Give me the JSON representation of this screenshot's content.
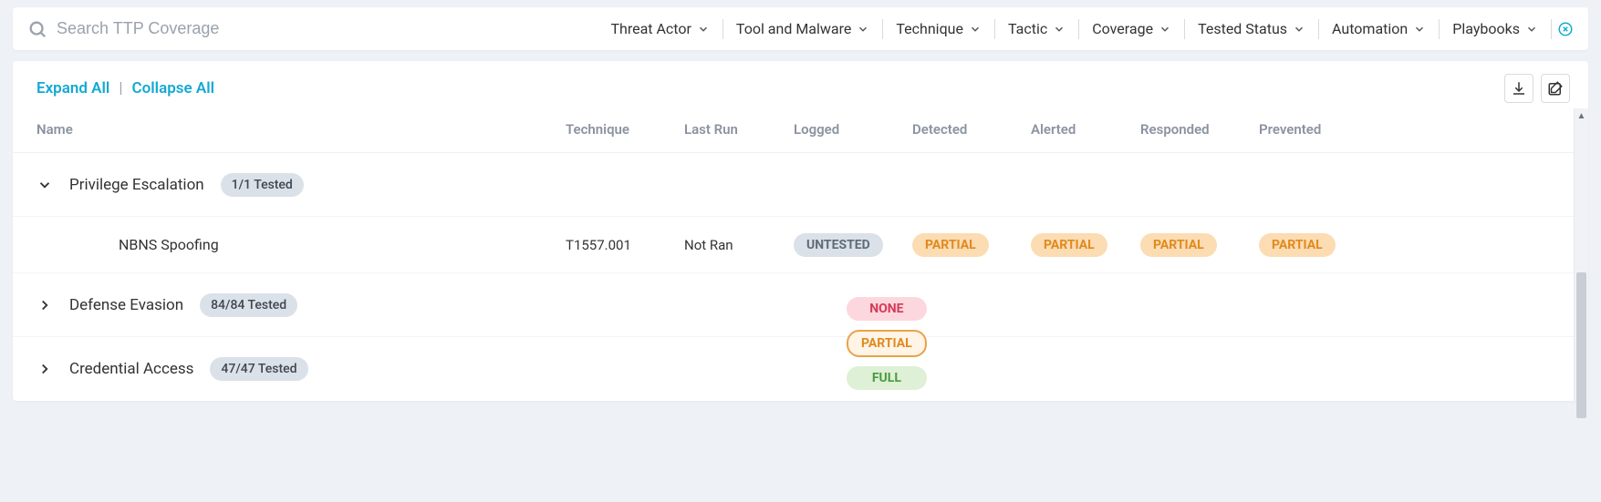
{
  "search": {
    "placeholder": "Search TTP Coverage"
  },
  "filters": [
    {
      "label": "Threat Actor"
    },
    {
      "label": "Tool and Malware"
    },
    {
      "label": "Technique"
    },
    {
      "label": "Tactic"
    },
    {
      "label": "Coverage"
    },
    {
      "label": "Tested Status"
    },
    {
      "label": "Automation"
    },
    {
      "label": "Playbooks"
    }
  ],
  "controls": {
    "expand": "Expand All",
    "collapse": "Collapse All"
  },
  "columns": {
    "name": "Name",
    "technique": "Technique",
    "lastRun": "Last Run",
    "logged": "Logged",
    "detected": "Detected",
    "alerted": "Alerted",
    "responded": "Responded",
    "prevented": "Prevented"
  },
  "groups": [
    {
      "name": "Privilege Escalation",
      "count": "1/1 Tested",
      "expanded": true
    },
    {
      "name": "Defense Evasion",
      "count": "84/84 Tested",
      "expanded": false
    },
    {
      "name": "Credential Access",
      "count": "47/47 Tested",
      "expanded": false
    }
  ],
  "rows": [
    {
      "name": "NBNS Spoofing",
      "technique": "T1557.001",
      "lastRun": "Not Ran",
      "logged": "UNTESTED",
      "detected": "PARTIAL",
      "alerted": "PARTIAL",
      "responded": "PARTIAL",
      "prevented": "PARTIAL"
    }
  ],
  "legend": {
    "none": "NONE",
    "partial": "PARTIAL",
    "full": "FULL"
  }
}
